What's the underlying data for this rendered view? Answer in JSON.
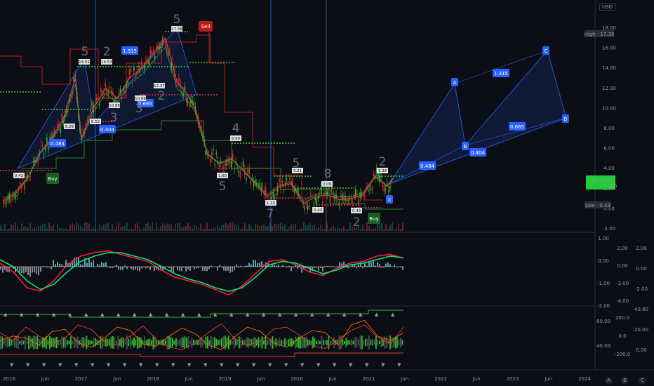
{
  "currency": "USD",
  "scale_buttons": [
    "A",
    "B",
    "C"
  ],
  "chart_data": [
    {
      "type": "line",
      "title": "",
      "yscale": "log",
      "ylim": [
        -2.0,
        20.0
      ],
      "y_ticks": [
        "18.00",
        "16.00",
        "14.00",
        "12.00",
        "10.00",
        "8.00",
        "6.00",
        "4.00",
        "2.00",
        "0.00",
        "-2.00"
      ],
      "x_ticks": [
        "2016",
        "Jun",
        "2017",
        "Jun",
        "2018",
        "Jun",
        "2019",
        "Jun",
        "2020",
        "Jun",
        "2021",
        "Jun",
        "2022",
        "Jun",
        "2023",
        "Jun",
        "2024"
      ],
      "price_labels": {
        "high": "High · 17.35",
        "low": "Low · 0.43",
        "last_symbol": "REI",
        "last_value": "3.00",
        "last_time": "1d 10h"
      },
      "price_series": [
        [
          "2016-01",
          0.8
        ],
        [
          "2016-03",
          1.5
        ],
        [
          "2016-05",
          3.0
        ],
        [
          "2016-07",
          5.5
        ],
        [
          "2016-09",
          7.0
        ],
        [
          "2016-11",
          9.0
        ],
        [
          "2017-01",
          13.0
        ],
        [
          "2017-02",
          7.0
        ],
        [
          "2017-04",
          10.0
        ],
        [
          "2017-06",
          12.0
        ],
        [
          "2017-08",
          11.0
        ],
        [
          "2017-10",
          13.0
        ],
        [
          "2017-12",
          14.0
        ],
        [
          "2018-02",
          15.5
        ],
        [
          "2018-04",
          17.0
        ],
        [
          "2018-06",
          12.5
        ],
        [
          "2018-07",
          12.0
        ],
        [
          "2018-09",
          10.0
        ],
        [
          "2018-11",
          5.5
        ],
        [
          "2019-01",
          4.5
        ],
        [
          "2019-03",
          5.0
        ],
        [
          "2019-05",
          3.8
        ],
        [
          "2019-07",
          2.5
        ],
        [
          "2019-09",
          1.2
        ],
        [
          "2019-11",
          2.2
        ],
        [
          "2020-01",
          2.5
        ],
        [
          "2020-03",
          0.5
        ],
        [
          "2020-05",
          1.2
        ],
        [
          "2020-07",
          1.4
        ],
        [
          "2020-09",
          0.9
        ],
        [
          "2020-11",
          1.0
        ],
        [
          "2021-01",
          1.4
        ],
        [
          "2021-03",
          3.2
        ],
        [
          "2021-05",
          2.2
        ],
        [
          "2021-06",
          3.0
        ]
      ],
      "fractal_up": [
        {
          "date": "2016-11",
          "label": "14.01"
        },
        {
          "date": "2017-01",
          "label": "14.53"
        },
        {
          "date": "2018-04",
          "label": "17.35"
        },
        {
          "date": "2018-12",
          "label": "6.80"
        },
        {
          "date": "2019-10",
          "label": "3.31"
        },
        {
          "date": "2020-05",
          "label": "2.09"
        },
        {
          "date": "2021-02",
          "label": "3.38"
        }
      ],
      "fractal_down": [
        {
          "date": "2016-01",
          "label": "0.43"
        },
        {
          "date": "2016-08",
          "label": "8.29"
        },
        {
          "date": "2017-02",
          "label": "8.52"
        },
        {
          "date": "2017-05",
          "label": "10.88"
        },
        {
          "date": "2018-01",
          "label": "10.88"
        },
        {
          "date": "2018-04",
          "label": "12.37"
        },
        {
          "date": "2019-02",
          "label": "1.60"
        },
        {
          "date": "2019-08",
          "label": "1.23"
        },
        {
          "date": "2020-03",
          "label": "0.43"
        },
        {
          "date": "2020-09",
          "label": "0.43"
        }
      ],
      "harmonic_labels": [
        "A",
        "B",
        "C",
        "D",
        "X"
      ],
      "ratio_labels": [
        "1.315",
        "0.665",
        "0.484",
        "0.404",
        "1.315",
        "0.665",
        "0.484",
        "0.404"
      ],
      "wave_numbers": [
        "5",
        "2",
        "3",
        "3",
        "2",
        "5",
        "4",
        "5",
        "5",
        "8",
        "7",
        "2",
        "2"
      ],
      "signals": {
        "buy": "Buy",
        "sell": "Sell"
      }
    },
    {
      "type": "line",
      "title": "",
      "y_ticks_left": [
        "1.00",
        "0.00",
        "-1.00",
        "-2.00"
      ],
      "y_ticks_mid": [
        "2.00",
        "0.00",
        "-2.00",
        "-4.00"
      ],
      "y_ticks_right": [
        "2.00",
        "0.00",
        "-2.00"
      ],
      "series": [
        {
          "values": [
            0.2,
            -0.3,
            -1.2,
            -1.4,
            -0.8,
            0.1,
            0.6,
            0.8,
            0.9,
            0.7,
            0.5,
            0.3,
            -0.2,
            -0.6,
            -0.8,
            -1.0,
            -1.3,
            -1.6,
            -1.1,
            -0.4,
            0.3,
            0.4,
            0.1,
            -0.3,
            -0.5,
            -0.1,
            0.2,
            0.3,
            0.6,
            0.7,
            0.5
          ]
        },
        {
          "values": [
            0.4,
            0.0,
            -0.8,
            -1.3,
            -1.0,
            -0.3,
            0.3,
            0.6,
            0.8,
            0.8,
            0.6,
            0.4,
            0.0,
            -0.4,
            -0.7,
            -0.9,
            -1.2,
            -1.4,
            -1.2,
            -0.6,
            0.1,
            0.3,
            0.2,
            -0.1,
            -0.4,
            -0.2,
            0.1,
            0.2,
            0.4,
            0.6,
            0.5
          ]
        }
      ]
    },
    {
      "type": "line",
      "title": "",
      "y_ticks_left": [
        "60.00",
        "40.00"
      ],
      "y_ticks_mid": [
        "200.0",
        "0.0",
        "-200.0"
      ],
      "y_ticks_right": [
        "40.00",
        "20.00",
        "0.00"
      ],
      "series": [
        {
          "values": [
            55,
            48,
            60,
            52,
            45,
            50,
            62,
            58,
            47,
            44,
            52,
            61,
            49,
            42,
            40,
            46,
            55,
            63,
            50,
            44,
            47,
            58,
            60,
            53,
            43,
            41,
            49,
            57,
            62,
            51,
            45,
            60
          ]
        },
        {
          "values": [
            48,
            52,
            50,
            44,
            56,
            58,
            46,
            42,
            50,
            60,
            57,
            45,
            43,
            52,
            59,
            54,
            44,
            40,
            51,
            60,
            56,
            46,
            42,
            50,
            57,
            55,
            44,
            62,
            66,
            52,
            48,
            55
          ]
        }
      ]
    }
  ]
}
